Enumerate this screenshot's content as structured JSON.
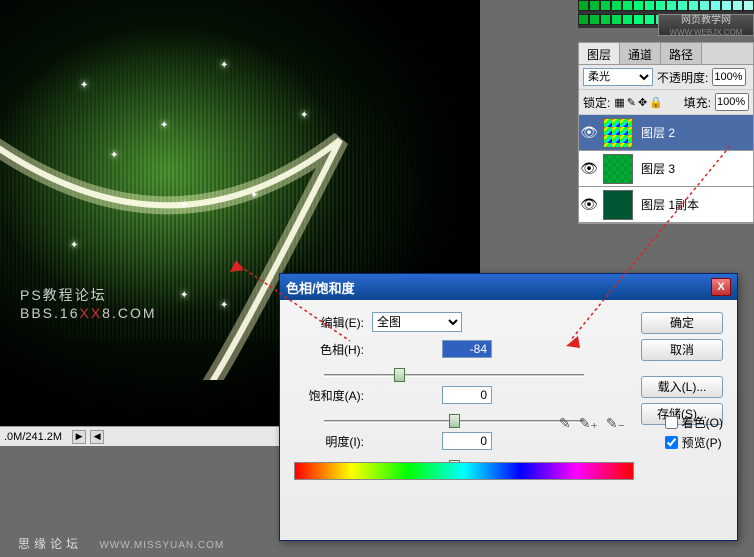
{
  "canvas": {
    "watermark_top": "PS教程论坛",
    "watermark_bottom_pre": "BBS.16",
    "watermark_bottom_mid": "XX",
    "watermark_bottom_post": "8.COM"
  },
  "status": {
    "text": ".0M/241.2M",
    "arrow_left": "◀",
    "arrow_right": "▶"
  },
  "swatches_brand": {
    "line1": "网页教学网",
    "line2": "WWW.WEBJX.COM",
    "colors": [
      "#0a2",
      "#0b3",
      "#0c4",
      "#0d5",
      "#0e6",
      "#0f7",
      "#1f8",
      "#2f9",
      "#3fa",
      "#4fb",
      "#5fc",
      "#6fd",
      "#7fe",
      "#8fe",
      "#9fe",
      "#afe"
    ]
  },
  "layers": {
    "tabs": [
      "图层",
      "通道",
      "路径"
    ],
    "blend_mode_label": "",
    "blend_mode_value": "柔光",
    "opacity_label": "不透明度:",
    "opacity_value": "100%",
    "lock_label": "锁定:",
    "fill_label": "填充:",
    "fill_value": "100%",
    "items": [
      {
        "name": "图层 2",
        "thumb_bg": "linear-gradient(135deg,#f00,#ff0,#0f0,#0ff,#00f,#f0f)",
        "selected": true
      },
      {
        "name": "图层 3",
        "thumb_bg": "repeating-conic-gradient(#0a3 0% 25%, #093 25% 50%)",
        "selected": false
      },
      {
        "name": "图层 1副本",
        "thumb_bg": "#053",
        "selected": false
      }
    ]
  },
  "dialog": {
    "title": "色相/饱和度",
    "edit_label": "编辑(E):",
    "edit_value": "全图",
    "hue_label": "色相(H):",
    "hue_value": "-84",
    "sat_label": "饱和度(A):",
    "sat_value": "0",
    "light_label": "明度(I):",
    "light_value": "0",
    "btn_ok": "确定",
    "btn_cancel": "取消",
    "btn_load": "载入(L)...",
    "btn_save": "存储(S)...",
    "chk_colorize": "着色(O)",
    "chk_preview": "预览(P)",
    "close_x": "X"
  },
  "footer": {
    "text": "思缘论坛",
    "url": "WWW.MISSYUAN.COM"
  }
}
